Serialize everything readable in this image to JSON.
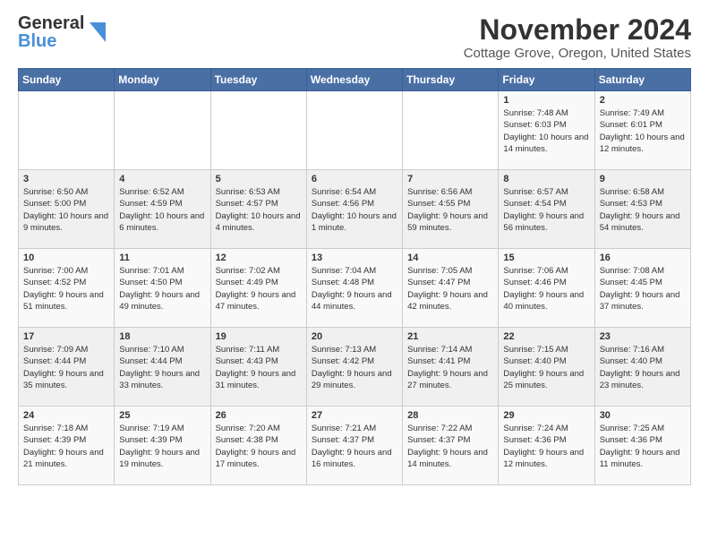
{
  "logo": {
    "line1": "General",
    "line2": "Blue"
  },
  "title": {
    "month": "November 2024",
    "location": "Cottage Grove, Oregon, United States"
  },
  "headers": [
    "Sunday",
    "Monday",
    "Tuesday",
    "Wednesday",
    "Thursday",
    "Friday",
    "Saturday"
  ],
  "weeks": [
    [
      {
        "day": "",
        "info": ""
      },
      {
        "day": "",
        "info": ""
      },
      {
        "day": "",
        "info": ""
      },
      {
        "day": "",
        "info": ""
      },
      {
        "day": "",
        "info": ""
      },
      {
        "day": "1",
        "info": "Sunrise: 7:48 AM\nSunset: 6:03 PM\nDaylight: 10 hours and 14 minutes."
      },
      {
        "day": "2",
        "info": "Sunrise: 7:49 AM\nSunset: 6:01 PM\nDaylight: 10 hours and 12 minutes."
      }
    ],
    [
      {
        "day": "3",
        "info": "Sunrise: 6:50 AM\nSunset: 5:00 PM\nDaylight: 10 hours and 9 minutes."
      },
      {
        "day": "4",
        "info": "Sunrise: 6:52 AM\nSunset: 4:59 PM\nDaylight: 10 hours and 6 minutes."
      },
      {
        "day": "5",
        "info": "Sunrise: 6:53 AM\nSunset: 4:57 PM\nDaylight: 10 hours and 4 minutes."
      },
      {
        "day": "6",
        "info": "Sunrise: 6:54 AM\nSunset: 4:56 PM\nDaylight: 10 hours and 1 minute."
      },
      {
        "day": "7",
        "info": "Sunrise: 6:56 AM\nSunset: 4:55 PM\nDaylight: 9 hours and 59 minutes."
      },
      {
        "day": "8",
        "info": "Sunrise: 6:57 AM\nSunset: 4:54 PM\nDaylight: 9 hours and 56 minutes."
      },
      {
        "day": "9",
        "info": "Sunrise: 6:58 AM\nSunset: 4:53 PM\nDaylight: 9 hours and 54 minutes."
      }
    ],
    [
      {
        "day": "10",
        "info": "Sunrise: 7:00 AM\nSunset: 4:52 PM\nDaylight: 9 hours and 51 minutes."
      },
      {
        "day": "11",
        "info": "Sunrise: 7:01 AM\nSunset: 4:50 PM\nDaylight: 9 hours and 49 minutes."
      },
      {
        "day": "12",
        "info": "Sunrise: 7:02 AM\nSunset: 4:49 PM\nDaylight: 9 hours and 47 minutes."
      },
      {
        "day": "13",
        "info": "Sunrise: 7:04 AM\nSunset: 4:48 PM\nDaylight: 9 hours and 44 minutes."
      },
      {
        "day": "14",
        "info": "Sunrise: 7:05 AM\nSunset: 4:47 PM\nDaylight: 9 hours and 42 minutes."
      },
      {
        "day": "15",
        "info": "Sunrise: 7:06 AM\nSunset: 4:46 PM\nDaylight: 9 hours and 40 minutes."
      },
      {
        "day": "16",
        "info": "Sunrise: 7:08 AM\nSunset: 4:45 PM\nDaylight: 9 hours and 37 minutes."
      }
    ],
    [
      {
        "day": "17",
        "info": "Sunrise: 7:09 AM\nSunset: 4:44 PM\nDaylight: 9 hours and 35 minutes."
      },
      {
        "day": "18",
        "info": "Sunrise: 7:10 AM\nSunset: 4:44 PM\nDaylight: 9 hours and 33 minutes."
      },
      {
        "day": "19",
        "info": "Sunrise: 7:11 AM\nSunset: 4:43 PM\nDaylight: 9 hours and 31 minutes."
      },
      {
        "day": "20",
        "info": "Sunrise: 7:13 AM\nSunset: 4:42 PM\nDaylight: 9 hours and 29 minutes."
      },
      {
        "day": "21",
        "info": "Sunrise: 7:14 AM\nSunset: 4:41 PM\nDaylight: 9 hours and 27 minutes."
      },
      {
        "day": "22",
        "info": "Sunrise: 7:15 AM\nSunset: 4:40 PM\nDaylight: 9 hours and 25 minutes."
      },
      {
        "day": "23",
        "info": "Sunrise: 7:16 AM\nSunset: 4:40 PM\nDaylight: 9 hours and 23 minutes."
      }
    ],
    [
      {
        "day": "24",
        "info": "Sunrise: 7:18 AM\nSunset: 4:39 PM\nDaylight: 9 hours and 21 minutes."
      },
      {
        "day": "25",
        "info": "Sunrise: 7:19 AM\nSunset: 4:39 PM\nDaylight: 9 hours and 19 minutes."
      },
      {
        "day": "26",
        "info": "Sunrise: 7:20 AM\nSunset: 4:38 PM\nDaylight: 9 hours and 17 minutes."
      },
      {
        "day": "27",
        "info": "Sunrise: 7:21 AM\nSunset: 4:37 PM\nDaylight: 9 hours and 16 minutes."
      },
      {
        "day": "28",
        "info": "Sunrise: 7:22 AM\nSunset: 4:37 PM\nDaylight: 9 hours and 14 minutes."
      },
      {
        "day": "29",
        "info": "Sunrise: 7:24 AM\nSunset: 4:36 PM\nDaylight: 9 hours and 12 minutes."
      },
      {
        "day": "30",
        "info": "Sunrise: 7:25 AM\nSunset: 4:36 PM\nDaylight: 9 hours and 11 minutes."
      }
    ]
  ]
}
